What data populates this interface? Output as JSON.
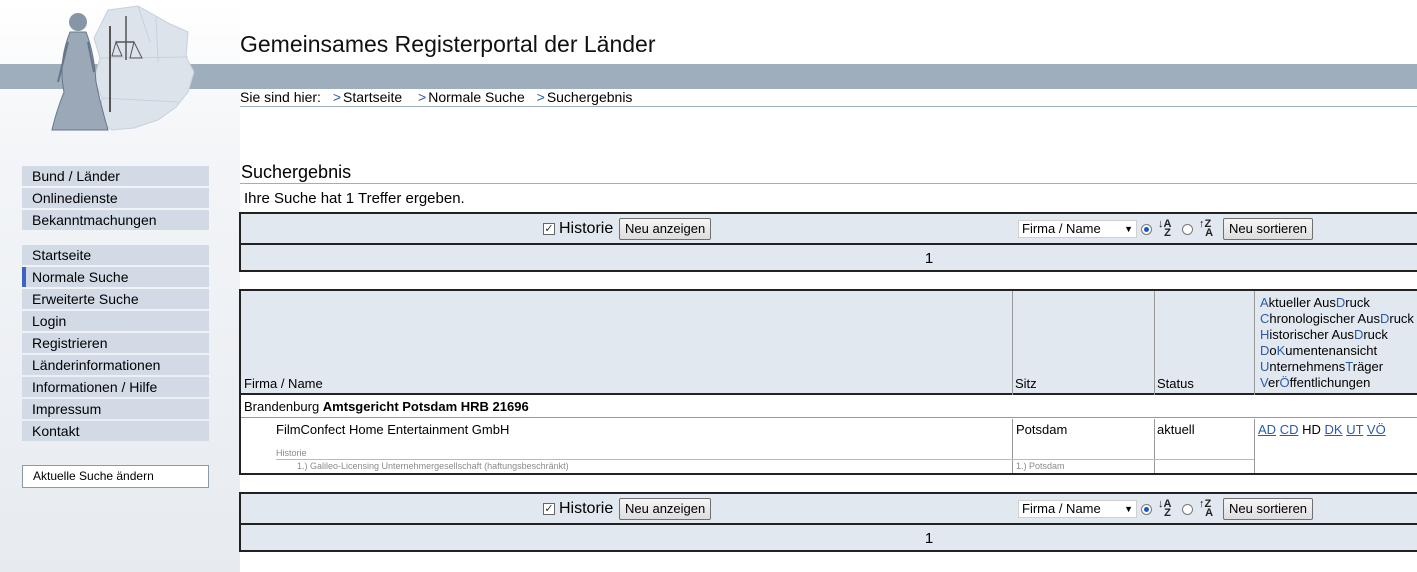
{
  "header": {
    "title": "Gemeinsames Registerportal der Länder",
    "breadcrumb_prefix": "Sie sind hier:",
    "breadcrumb": [
      "Startseite",
      "Normale Suche",
      "Suchergebnis"
    ],
    "breadcrumb_sep": ">"
  },
  "sidebar": {
    "group1": [
      "Bund / Länder",
      "Onlinedienste",
      "Bekanntmachungen"
    ],
    "group2": [
      "Startseite",
      "Normale Suche",
      "Erweiterte Suche",
      "Login",
      "Registrieren",
      "Länderinformationen",
      "Informationen / Hilfe",
      "Impressum",
      "Kontakt"
    ],
    "active": "Normale Suche",
    "change_search": "Aktuelle Suche ändern"
  },
  "main": {
    "section_title": "Suchergebnis",
    "hits_text": "Ihre Suche hat 1 Treffer ergeben.",
    "controls": {
      "historie_label": "Historie",
      "historie_checked": true,
      "show_button": "Neu anzeigen",
      "sort_select": "Firma / Name",
      "sort_button": "Neu sortieren",
      "page": "1"
    },
    "table": {
      "col_firma": "Firma / Name",
      "col_sitz": "Sitz",
      "col_status": "Status",
      "legend": [
        {
          "k1": "A",
          "t1": "ktueller Aus",
          "k2": "D",
          "t2": "ruck"
        },
        {
          "k1": "C",
          "t1": "hronologischer Aus",
          "k2": "D",
          "t2": "ruck"
        },
        {
          "k1": "H",
          "t1": "istorischer Aus",
          "k2": "D",
          "t2": "ruck"
        },
        {
          "k1": "D",
          "t1": "o",
          "k2": "K",
          "t2": "umentenansicht"
        },
        {
          "k1": "U",
          "t1": "nternehmens",
          "k2": "T",
          "t2": "räger"
        },
        {
          "k1": "V",
          "t1": "er",
          "k2": "Ö",
          "t2": "ffentlichungen"
        }
      ],
      "court_state": "Brandenburg",
      "court_name": "Amtsgericht Potsdam HRB 21696",
      "company": "FilmConfect Home Entertainment GmbH",
      "sitz": "Potsdam",
      "status": "aktuell",
      "doc_links": [
        "AD",
        "CD",
        "HD",
        "DK",
        "UT",
        "VÖ"
      ],
      "doc_links_active": [
        "AD",
        "CD",
        "DK",
        "UT",
        "VÖ"
      ],
      "historie_label": "Historie",
      "history_name": "1.) Galileo-Licensing Unternehmergesellschaft (haftungsbeschränkt)",
      "history_sitz": "1.) Potsdam"
    }
  },
  "colors": {
    "band": "#9eaebd",
    "nav_bg": "#d2dbe5",
    "panel_bg": "#e2e8ef",
    "link": "#2a5caa"
  }
}
